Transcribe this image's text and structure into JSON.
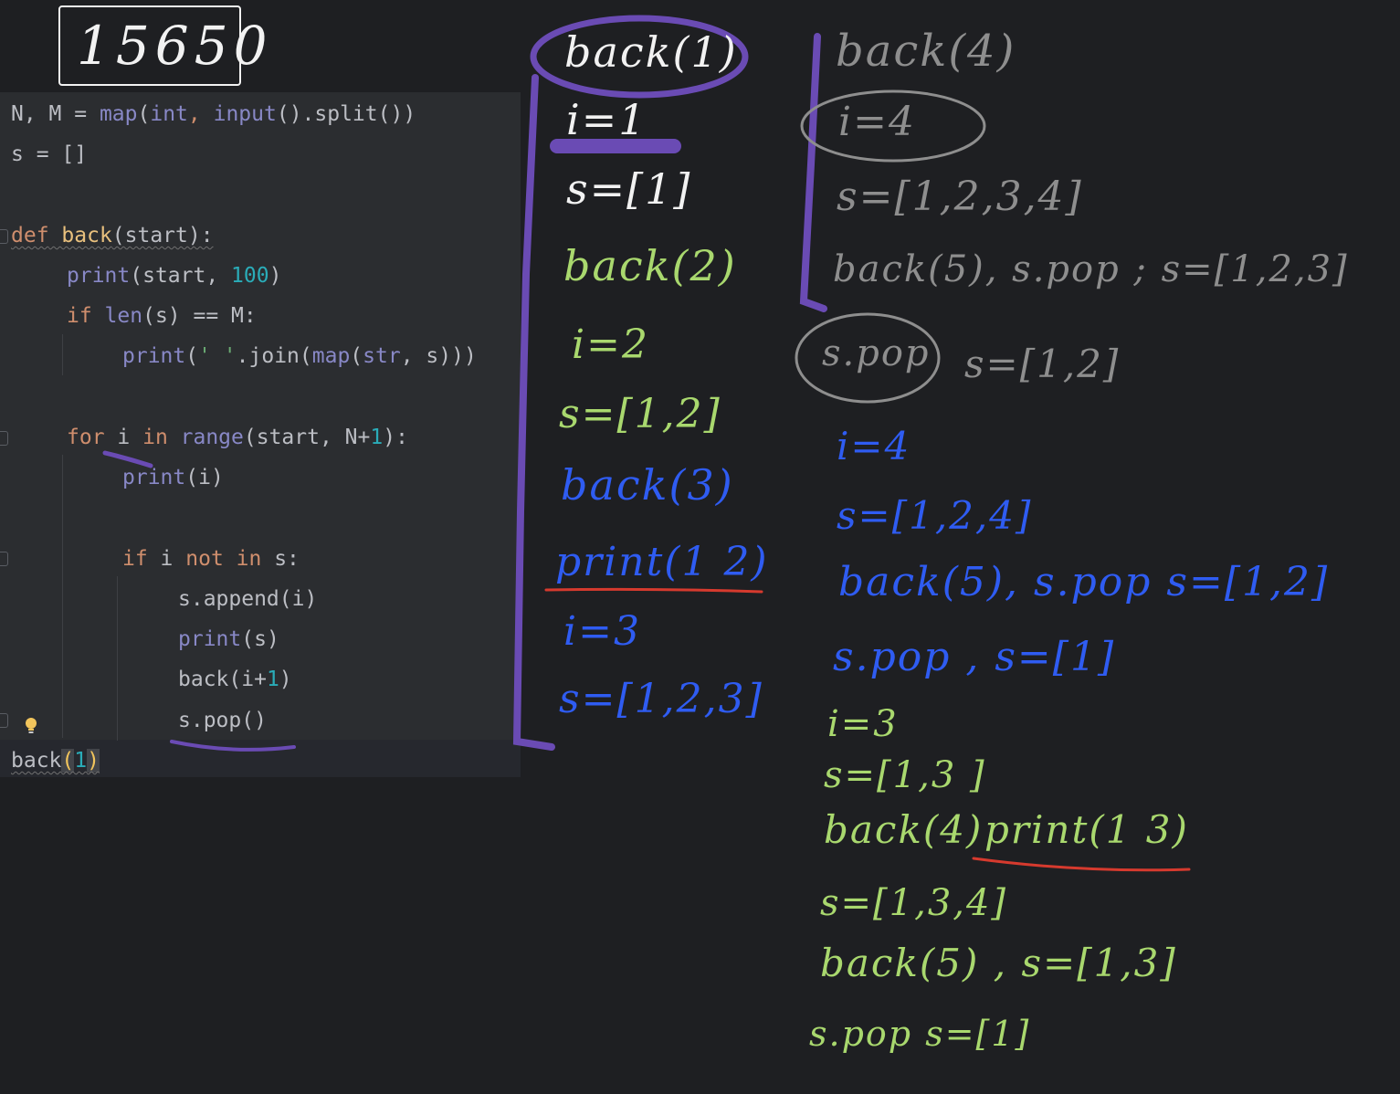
{
  "title_box": "15650",
  "code": {
    "l1": {
      "a": "N, M = ",
      "b": "map",
      "c": "(",
      "d": "int",
      "e": ", ",
      "f": "input",
      "g": "().split())"
    },
    "l2": "s = []",
    "l4": {
      "def": "def",
      "name": "back",
      "args": "(start):"
    },
    "l5": {
      "a": "print",
      "b": "(start, ",
      "c": "100",
      "d": ")"
    },
    "l6": {
      "a": "if ",
      "b": "len",
      "c": "(s) == M:"
    },
    "l7": {
      "a": "print",
      "b": "(",
      "c": "' '",
      "d": ".join(",
      "e": "map",
      "f": "(",
      "g": "str",
      "h": ", s)))"
    },
    "l9": {
      "a": "for ",
      "b": "i ",
      "c": "in ",
      "d": "range",
      "e": "(start, N+",
      "f": "1",
      "g": "):"
    },
    "l10": {
      "a": "print",
      "b": "(i)"
    },
    "l12": {
      "a": "if ",
      "b": "i ",
      "c": "not in ",
      "d": "s:"
    },
    "l13": "s.append(i)",
    "l14": {
      "a": "print",
      "b": "(s)"
    },
    "l15": {
      "a": "back(i+",
      "b": "1",
      "c": ")"
    },
    "l16": "s.pop()",
    "l17": {
      "a": "back",
      "b": "(",
      "c": "1",
      "d": ")"
    }
  },
  "notes": {
    "col1": [
      "back(1)",
      "i=1",
      "s=[1]",
      "back(2)",
      "i=2",
      "s=[1,2]",
      "back(3)",
      "print(1 2)",
      "i=3",
      "s=[1,2,3]"
    ],
    "col2_gray": [
      "back(4)",
      "i=4",
      "s=[1,2,3,4]",
      "back(5), s.pop ; s=[1,2,3]",
      "s.pop",
      "s=[1,2]"
    ],
    "col2_blue": [
      "i=4",
      "s=[1,2,4]",
      "back(5), s.pop  s=[1,2]",
      "s.pop , s=[1]"
    ],
    "col2_green": [
      "i=3",
      "s=[1,3 ]",
      "back(4)",
      "print(1 3)",
      "s=[1,3,4]",
      "back(5) , s=[1,3]",
      "s.pop  s=[1]"
    ]
  },
  "colors": {
    "white": "#f2f2f2",
    "gray": "#8e8e8e",
    "green": "#a9d86e",
    "blue": "#2f5cf2",
    "purple": "#6a4bb4",
    "red": "#d63a2e"
  }
}
